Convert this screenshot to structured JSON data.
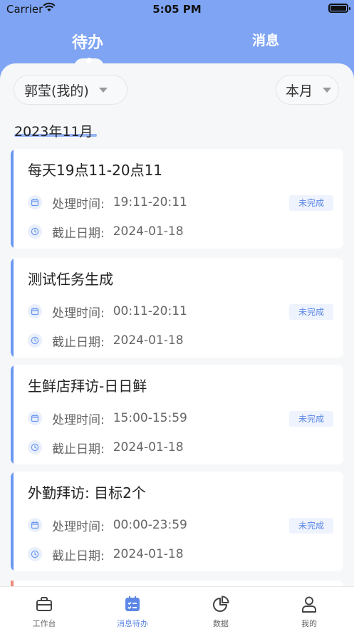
{
  "status_bar": {
    "carrier": "Carrier",
    "time": "5:05 PM"
  },
  "tabs": {
    "todo": "待办",
    "messages": "消息",
    "active": "todo"
  },
  "filters": {
    "user": "郭莹(我的)",
    "period": "本月"
  },
  "month_title": "2023年11月",
  "labels": {
    "process_time": "处理时间:",
    "deadline": "截止日期:"
  },
  "tasks": [
    {
      "title": "每天19点11-20点11",
      "time": "19:11-20:11",
      "deadline": "2024-01-18",
      "status": "未完成"
    },
    {
      "title": "测试任务生成",
      "time": "00:11-20:11",
      "deadline": "2024-01-18",
      "status": "未完成"
    },
    {
      "title": "生鲜店拜访-日日鲜",
      "time": "15:00-15:59",
      "deadline": "2024-01-18",
      "status": "未完成"
    },
    {
      "title": "外勤拜访: 目标2个",
      "time": "00:00-23:59",
      "deadline": "2024-01-18",
      "status": "未完成"
    }
  ],
  "tabbar": [
    {
      "label": "工作台",
      "icon": "briefcase-icon"
    },
    {
      "label": "消息待办",
      "icon": "task-list-icon",
      "active": true
    },
    {
      "label": "数据",
      "icon": "pie-chart-icon"
    },
    {
      "label": "我的",
      "icon": "user-icon"
    }
  ],
  "colors": {
    "accent": "#7ea4f3",
    "card_bar": "#6b98f2",
    "badge_text": "#5c87e6",
    "next_card_bar": "#f08a7a"
  }
}
